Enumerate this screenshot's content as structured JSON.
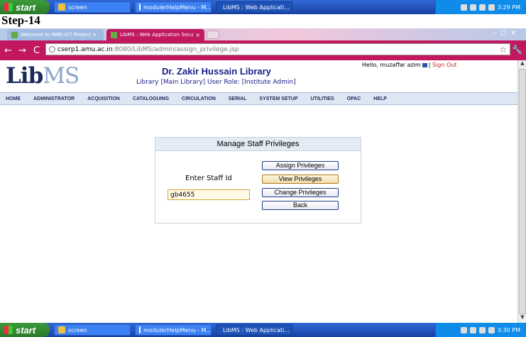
{
  "taskbar": {
    "start_label": "start",
    "tasks": [
      "screen",
      "modulerHelpMenu - M...",
      "LibMS : Web Applicati..."
    ],
    "clock_top": "3:29 PM",
    "clock_bottom": "3:30 PM"
  },
  "step_label": "Step-14",
  "browser": {
    "tab_inactive": "Welcome to NME-ICT Project ×",
    "tab_active": "LibMS : Web Application Secu",
    "tab_close": "×",
    "url_host": "cserp1.amu.ac.in",
    "url_path": ":8080/LibMS/admin/assign_privilege.jsp"
  },
  "header": {
    "logo_main": "Lib",
    "logo_ms": "MS",
    "library_title": "Dr. Zakir Hussain Library",
    "library_sub": "Library [Main Library]  User Role: [Institute Admin]",
    "hello_text": "Hello,  muzaffar azim",
    "signout": "Sign Out"
  },
  "menu": [
    "HOME",
    "ADMINISTRATOR",
    "ACQUISITION",
    "CATALOGUING",
    "CIRCULATION",
    "SERIAL",
    "SYSTEM SETUP",
    "UTILITIES",
    "OPAC",
    "HELP"
  ],
  "panel": {
    "title": "Manage Staff Privileges",
    "staff_label": "Enter Staff Id",
    "staff_value": "gb4655",
    "buttons": [
      "Assign Privileges",
      "View Privileges",
      "Change Privileges",
      "Back"
    ]
  },
  "colors": {
    "browser_accent": "#c1185f",
    "taskbar": "#245edb",
    "menu_bg": "#dde6f3"
  }
}
